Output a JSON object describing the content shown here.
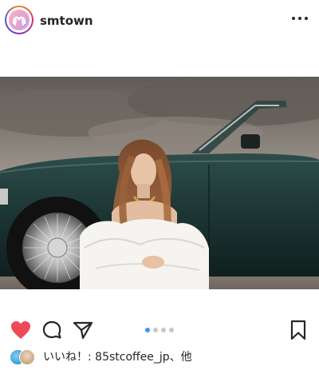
{
  "header": {
    "username": "smtown",
    "avatar_icon": "smtown-logo",
    "more_icon": "more-horizontal-icon"
  },
  "actions": {
    "like_icon": "heart-filled-icon",
    "like_color": "#ed4956",
    "comment_icon": "comment-icon",
    "share_icon": "share-paper-plane-icon",
    "save_icon": "bookmark-icon"
  },
  "carousel": {
    "count": 4,
    "active_index": 0,
    "active_color": "#3897f0"
  },
  "likes": {
    "text": "いいね！: 85stcoffee_jp、他"
  }
}
